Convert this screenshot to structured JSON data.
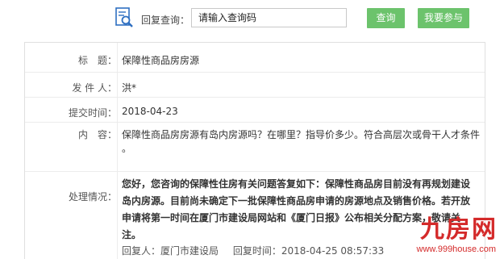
{
  "search": {
    "label": "回复查询：",
    "placeholder": "请输入查询码",
    "query_button": "查询",
    "join_button": "我要参与"
  },
  "details": {
    "title_label": "标　题：",
    "title_value": "保障性商品房房源",
    "sender_label": "发 件 人：",
    "sender_value": "洪*",
    "time_label": "提交时间：",
    "time_value": "2018-04-23",
    "content_label": "内　容：",
    "content_value": "保障性商品房房源有岛内房源吗？在哪里？指导价多少。符合高层次或骨干人才条件 。",
    "status_label": "处理情况：",
    "reply_text": "您好，您咨询的保障性住房有关问题答复如下：保障性商品房目前没有再规划建设岛内房源。目前尚未确定下一批保障性商品房申请的房源地点及销售价格。若开放申请将第一时间在厦门市建设局网站和《厦门日报》公布相关分配方案，敬请关注。",
    "reply_person": "回复人：厦门市建设局",
    "reply_time": "回复时间：2018-04-25 08:57:33"
  },
  "watermark": {
    "brand": "九房网",
    "url": "www.999house.com"
  },
  "colors": {
    "button": "#6cc36c",
    "watermark": "#d42a2a",
    "icon_blue": "#2e6fc1"
  }
}
